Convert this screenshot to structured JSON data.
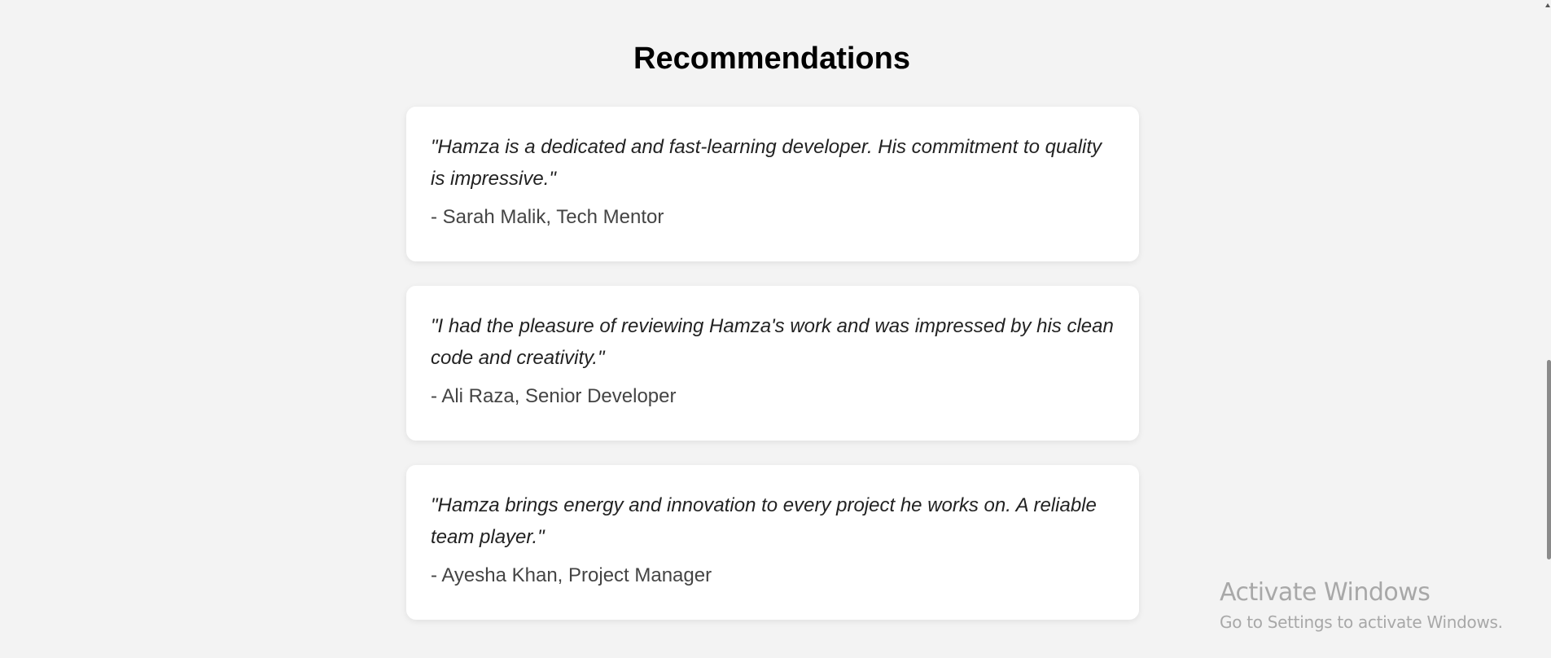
{
  "section": {
    "title": "Recommendations"
  },
  "recommendations": [
    {
      "quote": "\"Hamza is a dedicated and fast-learning developer. His commitment to quality is impressive.\"",
      "author": "- Sarah Malik, Tech Mentor"
    },
    {
      "quote": "\"I had the pleasure of reviewing Hamza's work and was impressed by his clean code and creativity.\"",
      "author": "- Ali Raza, Senior Developer"
    },
    {
      "quote": "\"Hamza brings energy and innovation to every project he works on. A reliable team player.\"",
      "author": "- Ayesha Khan, Project Manager"
    }
  ],
  "watermark": {
    "title": "Activate Windows",
    "subtitle": "Go to Settings to activate Windows."
  }
}
